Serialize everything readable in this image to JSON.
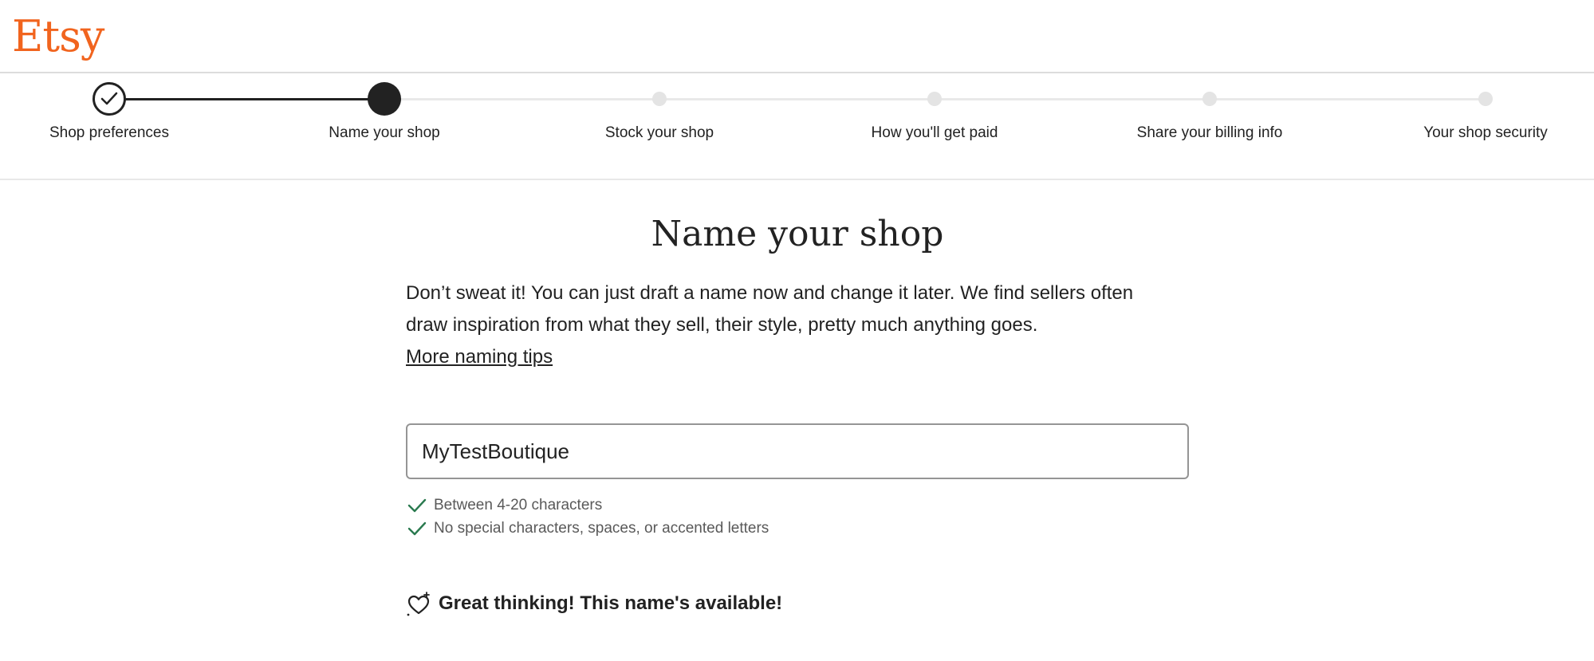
{
  "app": {
    "logo": "Etsy",
    "brand_color": "#f1641e"
  },
  "stepper": {
    "steps": [
      {
        "label": "Shop preferences",
        "state": "complete",
        "icon": "check-icon"
      },
      {
        "label": "Name your shop",
        "state": "current"
      },
      {
        "label": "Stock your shop",
        "state": "upcoming"
      },
      {
        "label": "How you'll get paid",
        "state": "upcoming"
      },
      {
        "label": "Share your billing info",
        "state": "upcoming"
      },
      {
        "label": "Your shop security",
        "state": "upcoming"
      }
    ]
  },
  "main": {
    "title": "Name your shop",
    "description": "Don’t sweat it! You can just draft a name now and change it later. We find sellers often draw inspiration from what they sell, their style, pretty much anything goes.",
    "tips_link": "More naming tips",
    "shop_name_input": {
      "value": "MyTestBoutique"
    },
    "rules": [
      {
        "text": "Between 4-20 characters",
        "met": true,
        "icon": "check-icon"
      },
      {
        "text": "No special characters, spaces, or accented letters",
        "met": true,
        "icon": "check-icon"
      }
    ],
    "rule_check_color": "#2a7a4f",
    "availability": {
      "icon": "heart-sparkle-icon",
      "text": "Great thinking! This name's available!"
    }
  }
}
